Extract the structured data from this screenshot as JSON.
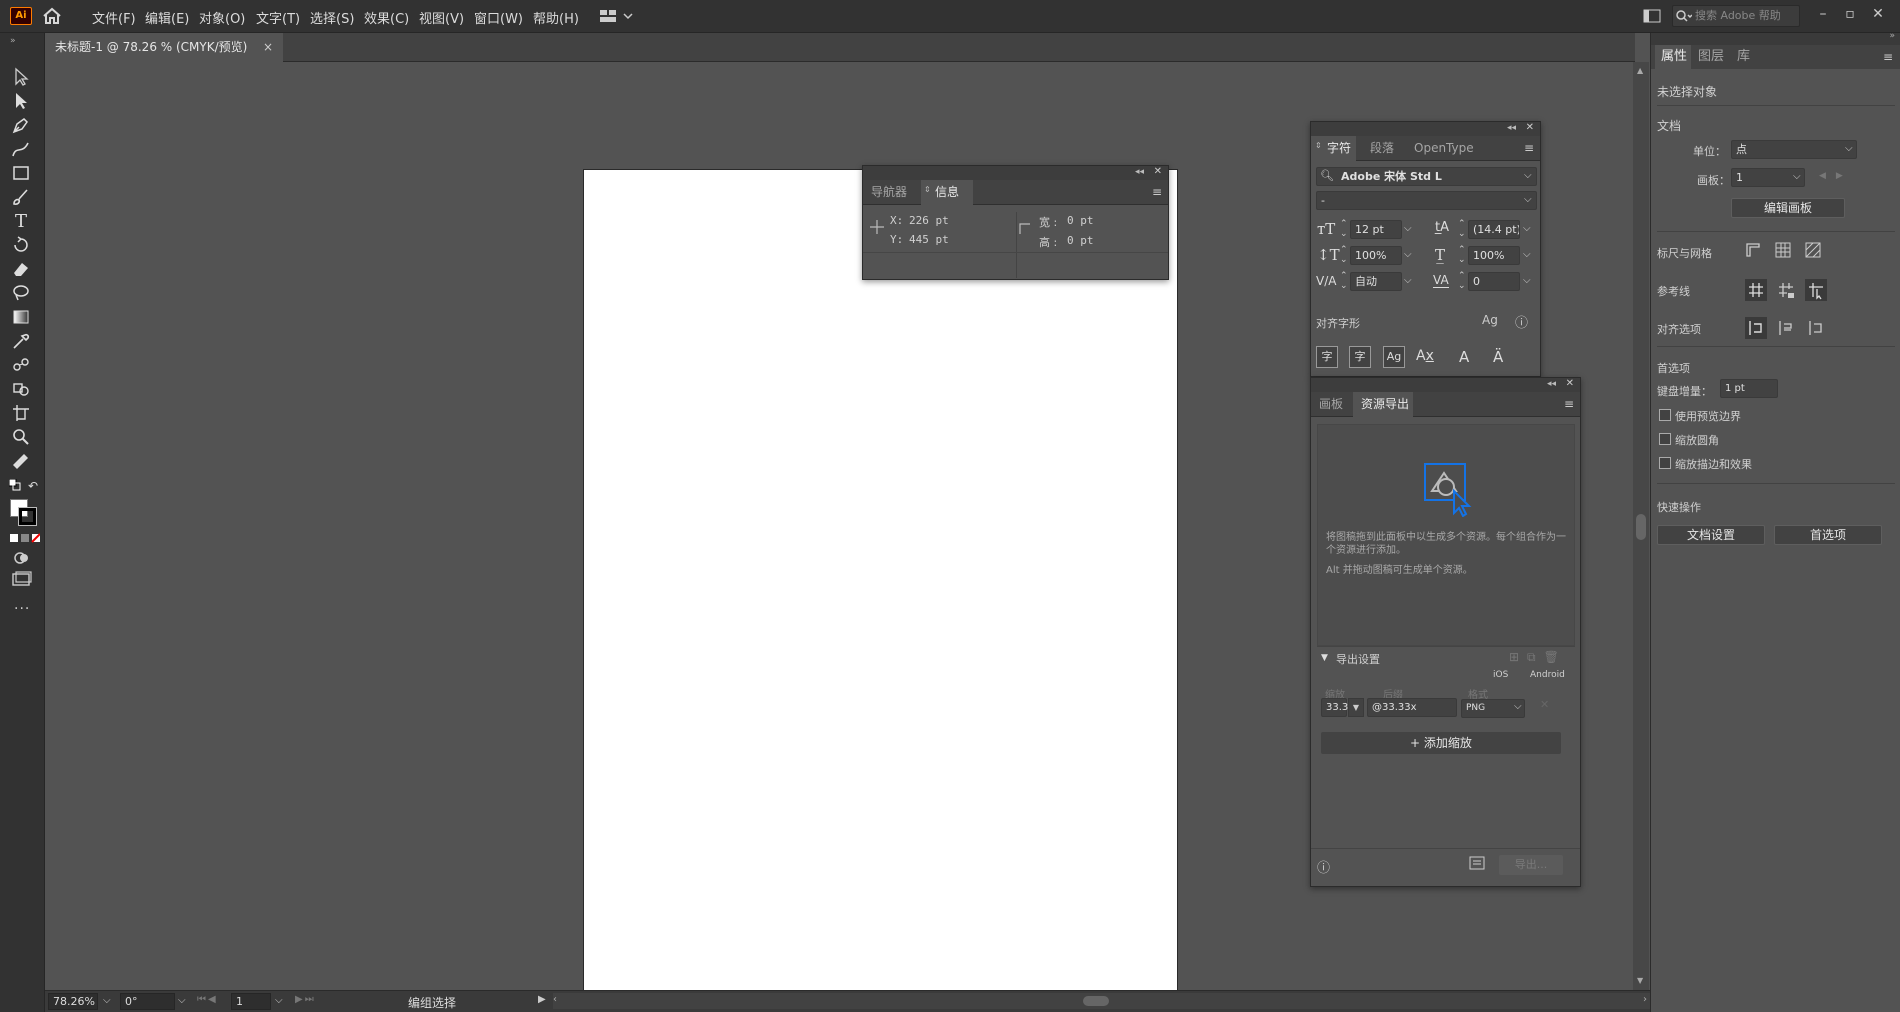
{
  "app": {
    "logo": "Ai"
  },
  "menu": [
    "文件(F)",
    "编辑(E)",
    "对象(O)",
    "文字(T)",
    "选择(S)",
    "效果(C)",
    "视图(V)",
    "窗口(W)",
    "帮助(H)"
  ],
  "search": {
    "placeholder": "搜索 Adobe 帮助"
  },
  "document_tab": {
    "title": "未标题-1 @ 78.26 % (CMYK/预览)",
    "close": "×"
  },
  "status": {
    "zoom": "78.26%",
    "rotation": "0°",
    "artboard": "1",
    "mode": "编组选择"
  },
  "info_panel": {
    "tabs": [
      "导航器",
      "信息"
    ],
    "x_label": "X:",
    "x_value": "226 pt",
    "y_label": "Y:",
    "y_value": "445 pt",
    "w_label": "宽 :",
    "w_value": "0 pt",
    "h_label": "高 :",
    "h_value": "0 pt"
  },
  "char_panel": {
    "tabs": [
      "字符",
      "段落",
      "OpenType"
    ],
    "font_family": "Adobe 宋体 Std L",
    "font_style": "-",
    "font_size": "12 pt",
    "leading": "(14.4 pt)",
    "vscale": "100%",
    "hscale": "100%",
    "kerning": "自动",
    "tracking": "0",
    "glyph_align_label": "对齐字形"
  },
  "asset_panel": {
    "tabs": [
      "画板",
      "资源导出"
    ],
    "hint1": "将图稿拖到此面板中以生成多个资源。每个组合作为一个资源进行添加。",
    "hint2": "Alt 并拖动图稿可生成单个资源。",
    "export_settings": "导出设置",
    "ios": "iOS",
    "android": "Android",
    "col_scale": "缩放",
    "col_suffix": "后缀",
    "col_format": "格式",
    "scale_value": "33.3",
    "suffix_value": "@33.33x",
    "format_value": "PNG",
    "add_scale": "添加缩放",
    "export_btn": "导出..."
  },
  "properties": {
    "tabs": [
      "属性",
      "图层",
      "库"
    ],
    "no_selection": "未选择对象",
    "document_section": "文档",
    "unit_label": "单位：",
    "unit_value": "点",
    "artboard_label": "画板：",
    "artboard_value": "1",
    "edit_artboard_btn": "编辑画板",
    "rulers_grid": "标尺与网格",
    "guides": "参考线",
    "snap_options": "对齐选项",
    "preferences_section": "首选项",
    "keyboard_increment_label": "键盘增量：",
    "keyboard_increment_value": "1 pt",
    "check_preview_bounds": "使用预览边界",
    "check_scale_corners": "缩放圆角",
    "check_scale_strokes": "缩放描边和效果",
    "quick_actions": "快速操作",
    "doc_setup_btn": "文档设置",
    "prefs_btn": "首选项"
  }
}
